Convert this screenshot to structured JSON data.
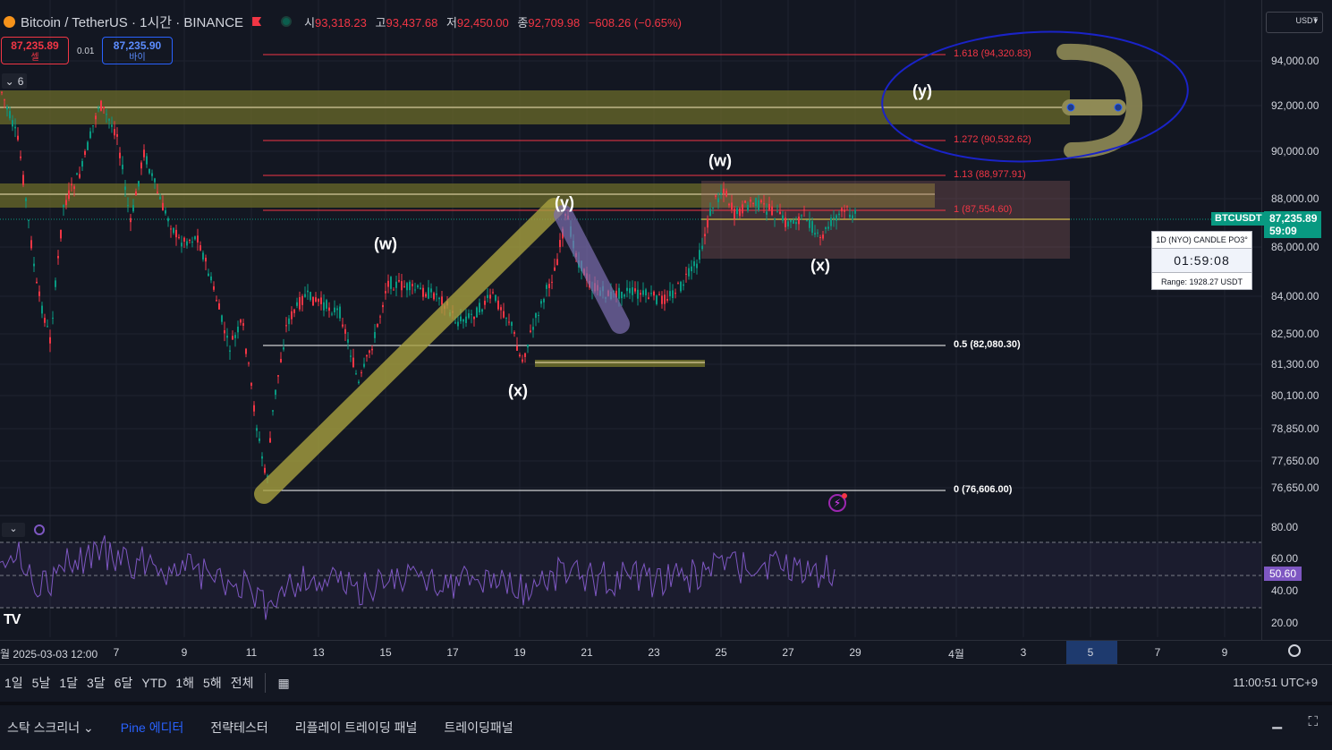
{
  "header": {
    "symbol": "Bitcoin / TetherUS · 1시간 · BINANCE",
    "open_label": "시",
    "open": "93,318.23",
    "high_label": "고",
    "high": "93,437.68",
    "low_label": "저",
    "low": "92,450.00",
    "close_label": "종",
    "close": "92,709.98",
    "change": "−608.26 (−0.65%)"
  },
  "trade": {
    "sell_price": "87,235.89",
    "sell_label": "셀",
    "spread": "0.01",
    "buy_price": "87,235.90",
    "buy_label": "바이"
  },
  "indicators_count": "6",
  "currency": "USDT",
  "price_axis": [
    "94,000.00",
    "92,000.00",
    "90,000.00",
    "88,000.00",
    "86,000.00",
    "84,000.00",
    "82,500.00",
    "81,300.00",
    "80,100.00",
    "78,850.00",
    "77,650.00",
    "76,650.00"
  ],
  "current": {
    "symbol": "BTCUSDT",
    "price": "87,235.89",
    "countdown": "59:09"
  },
  "rsi_axis": [
    "80.00",
    "60.00",
    "40.00",
    "20.00"
  ],
  "rsi_value": "50.60",
  "fib_levels": [
    {
      "label": "1.618 (94,320.83)",
      "color": "red"
    },
    {
      "label": "1.272 (90,532.62)",
      "color": "red"
    },
    {
      "label": "1.13 (88,977.91)",
      "color": "red"
    },
    {
      "label": "1 (87,554.60)",
      "color": "red"
    },
    {
      "label": "0.5 (82,080.30)",
      "color": "white"
    },
    {
      "label": "0 (76,606.00)",
      "color": "white"
    }
  ],
  "waves": [
    "(w)",
    "(x)",
    "(y)",
    "(w)",
    "(x)",
    "(y)"
  ],
  "widget": {
    "title": "1D (NYO) CANDLE PO3°",
    "timer": "01:59:08",
    "range": "Range: 1928.27 USDT"
  },
  "time_axis": [
    "월 2025-03-03   12:00",
    "7",
    "9",
    "11",
    "13",
    "15",
    "17",
    "19",
    "21",
    "23",
    "25",
    "27",
    "29",
    "4월",
    "3",
    "5",
    "7",
    "9"
  ],
  "ranges": [
    "1일",
    "5날",
    "1달",
    "3달",
    "6달",
    "YTD",
    "1해",
    "5해",
    "전체"
  ],
  "clock": "11:00:51 UTC+9",
  "bottom_tabs": [
    "스탁 스크리너",
    "Pine 에디터",
    "전략테스터",
    "리플레이 트레이딩 패널",
    "트레이딩패널"
  ],
  "colors": {
    "bg": "#131722",
    "up": "#089981",
    "down": "#f23645",
    "rsi": "#7e57c2",
    "highlight": "#8a8a3a"
  }
}
